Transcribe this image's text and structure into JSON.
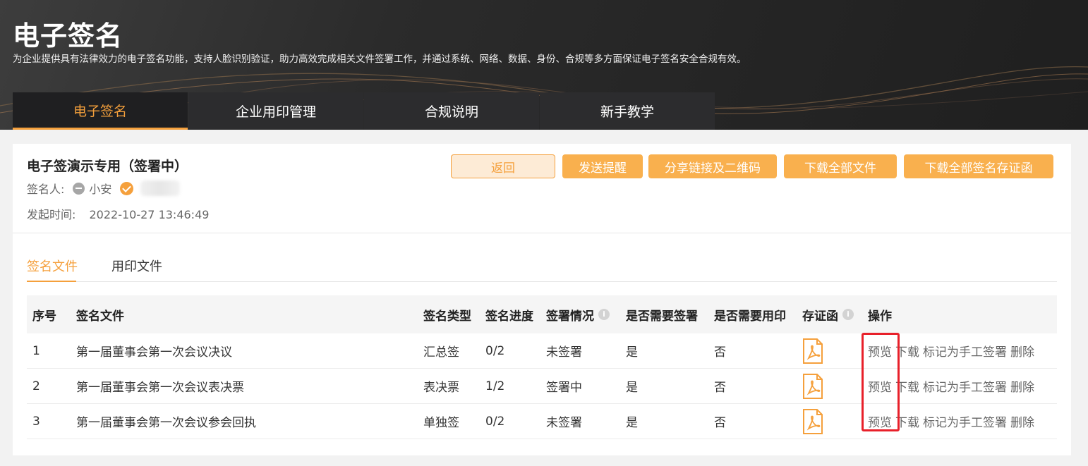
{
  "hero": {
    "title": "电子签名",
    "description": "为企业提供具有法律效力的电子签名功能，支持人脸识别验证，助力高效完成相关文件签署工作，并通过系统、网络、数据、身份、合规等多方面保证电子签名安全合规有效。"
  },
  "nav": {
    "tabs": [
      {
        "label": "电子签名",
        "active": true
      },
      {
        "label": "企业用印管理",
        "active": false
      },
      {
        "label": "合规说明",
        "active": false
      },
      {
        "label": "新手教学",
        "active": false
      }
    ]
  },
  "detail": {
    "title": "电子签演示专用（签署中）",
    "signer_label": "签名人:",
    "signer_name": "小安",
    "start_label": "发起时间:",
    "start_time": "2022-10-27 13:46:49"
  },
  "actions": {
    "back": "返回",
    "remind": "发送提醒",
    "share": "分享链接及二维码",
    "download_all": "下载全部文件",
    "download_certs": "下载全部签名存证函"
  },
  "subtabs": {
    "sign_files": "签名文件",
    "seal_files": "用印文件"
  },
  "table": {
    "headers": {
      "idx": "序号",
      "file": "签名文件",
      "type": "签名类型",
      "progress": "签名进度",
      "status": "签署情况",
      "need_sign": "是否需要签署",
      "need_seal": "是否需要用印",
      "cert": "存证函",
      "ops": "操作"
    },
    "rows": [
      {
        "idx": "1",
        "file": "第一届董事会第一次会议决议",
        "type": "汇总签",
        "progress": "0/2",
        "status": "未签署",
        "need_sign": "是",
        "need_seal": "否"
      },
      {
        "idx": "2",
        "file": "第一届董事会第一次会议表决票",
        "type": "表决票",
        "progress": "1/2",
        "status": "签署中",
        "need_sign": "是",
        "need_seal": "否"
      },
      {
        "idx": "3",
        "file": "第一届董事会第一次会议参会回执",
        "type": "单独签",
        "progress": "0/2",
        "status": "未签署",
        "need_sign": "是",
        "need_seal": "否"
      }
    ],
    "ops": {
      "preview": "预览",
      "download": "下载",
      "mark_manual": "标记为手工签署",
      "delete": "删除"
    }
  },
  "colors": {
    "accent": "#f5a03c",
    "button_fill": "#f9b04e",
    "highlight": "#e8202a"
  },
  "icons": [
    "minus-circle-icon",
    "check-circle-icon",
    "info-icon",
    "pdf-icon"
  ]
}
